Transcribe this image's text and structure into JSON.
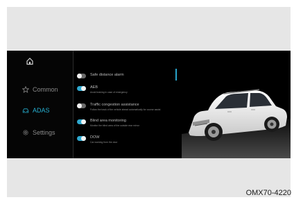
{
  "sidebar": {
    "home_icon": "home-icon",
    "items": [
      {
        "label": "Common",
        "icon": "star-icon",
        "active": false
      },
      {
        "label": "ADAS",
        "icon": "car-icon",
        "active": true
      },
      {
        "label": "Settings",
        "icon": "gear-icon",
        "active": false
      }
    ]
  },
  "settings": [
    {
      "title": "Safe distance alarm",
      "desc": "",
      "toggle": "off"
    },
    {
      "title": "AEB",
      "desc": "Avoid braking in case of emergency",
      "toggle": "on"
    },
    {
      "title": "Traffic congestion  assistance",
      "desc": "Follow the track of the vehicle ahead automatically for course assist",
      "toggle": "off"
    },
    {
      "title": "Blind area monitoring",
      "desc": "Monitor the blind area of the outside rear mirror",
      "toggle": "on"
    },
    {
      "title": "DOW",
      "desc": "Car warning from the door",
      "toggle": "on"
    }
  ],
  "colors": {
    "accent": "#27b2d4",
    "background": "#000000"
  },
  "caption": "OMX70-4220"
}
